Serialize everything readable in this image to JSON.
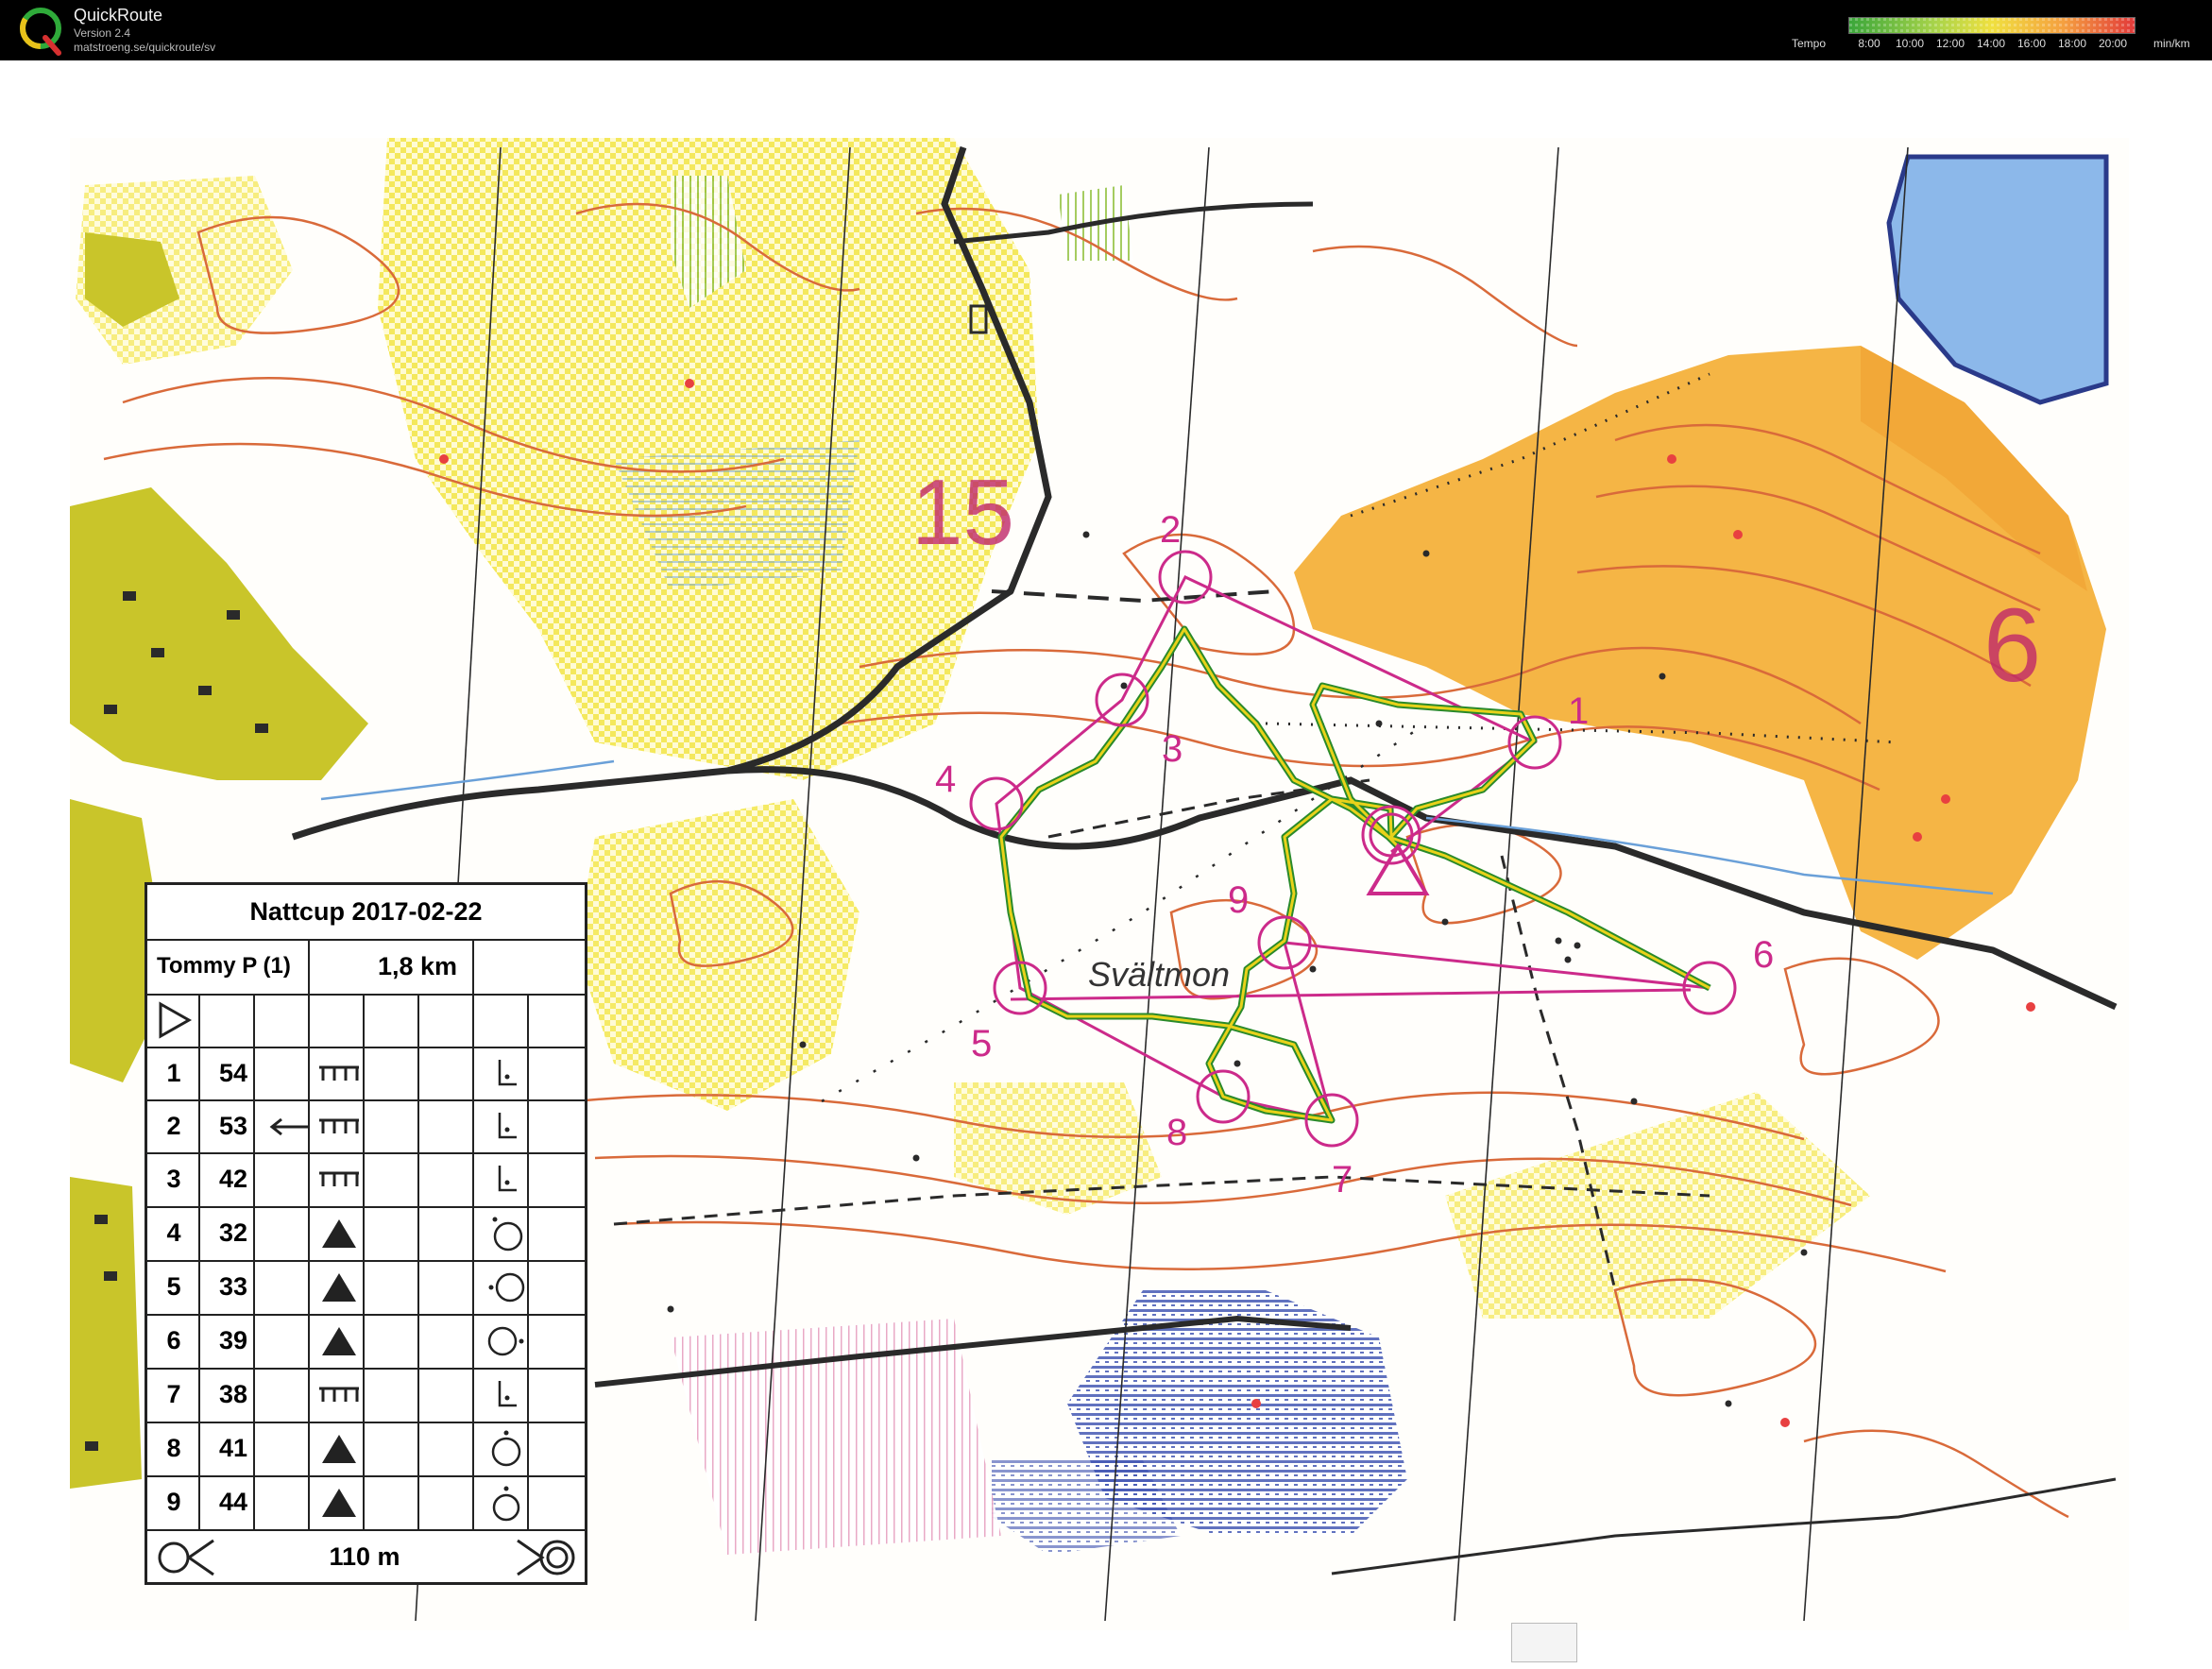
{
  "app": {
    "title": "QuickRoute",
    "version": "Version 2.4",
    "url": "matstroeng.se/quickroute/sv"
  },
  "tempo": {
    "label": "Tempo",
    "ticks": [
      "8:00",
      "10:00",
      "12:00",
      "14:00",
      "16:00",
      "18:00",
      "20:00"
    ],
    "unit": "min/km"
  },
  "map": {
    "place_name": "Svältmon",
    "big_labels": [
      "15",
      "6"
    ],
    "control_labels": [
      "1",
      "2",
      "3",
      "4",
      "5",
      "6",
      "7",
      "8",
      "9"
    ]
  },
  "legend": {
    "title": "Nattcup 2017-02-22",
    "runner": "Tommy P (1)",
    "distance": "1,8 km",
    "rows": [
      {
        "num": "1",
        "code": "54"
      },
      {
        "num": "2",
        "code": "53"
      },
      {
        "num": "3",
        "code": "42"
      },
      {
        "num": "4",
        "code": "32"
      },
      {
        "num": "5",
        "code": "33"
      },
      {
        "num": "6",
        "code": "39"
      },
      {
        "num": "7",
        "code": "38"
      },
      {
        "num": "8",
        "code": "41"
      },
      {
        "num": "9",
        "code": "44"
      }
    ],
    "finish_distance": "110 m"
  },
  "colors": {
    "course": "#cc2a8a",
    "contour": "#d96a3a",
    "open_land": "#f6e64a",
    "rough_open": "#f5b042",
    "vegetation": "#c6c12b",
    "water": "#5b8fd6",
    "route_yellow": "#e8d21a",
    "route_green": "#2a8a2a"
  }
}
